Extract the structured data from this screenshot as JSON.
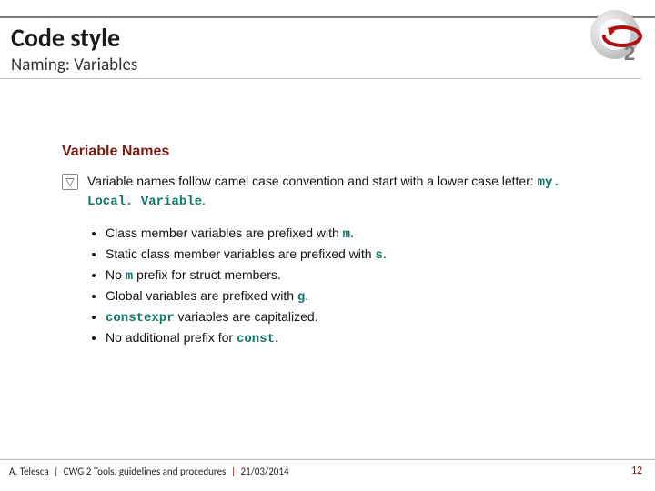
{
  "header": {
    "title": "Code style",
    "subtitle": "Naming: Variables"
  },
  "section": {
    "heading": "Variable Names",
    "triangle_glyph": "▽",
    "lead_pre": "Variable names follow camel case convention and start with a lower case letter: ",
    "lead_code": "my. Local. Variable",
    "lead_post": ".",
    "items": [
      {
        "pre": "Class member variables are prefixed with ",
        "code": "m",
        "post": "."
      },
      {
        "pre": "Static class member variables are prefixed with ",
        "code": "s",
        "post": "."
      },
      {
        "pre": "No ",
        "code": "m",
        "post": " prefix for struct members."
      },
      {
        "pre": "Global variables are prefixed with ",
        "code": "g",
        "post": "."
      },
      {
        "pre": "",
        "code": "constexpr",
        "post": " variables are capitalized."
      },
      {
        "pre": "No additional prefix for ",
        "code": "const",
        "post": "."
      }
    ]
  },
  "footer": {
    "author": "A. Telesca",
    "session": "CWG 2 Tools, guidelines and procedures",
    "date": "21/03/2014",
    "page": "12",
    "sep": "|"
  }
}
